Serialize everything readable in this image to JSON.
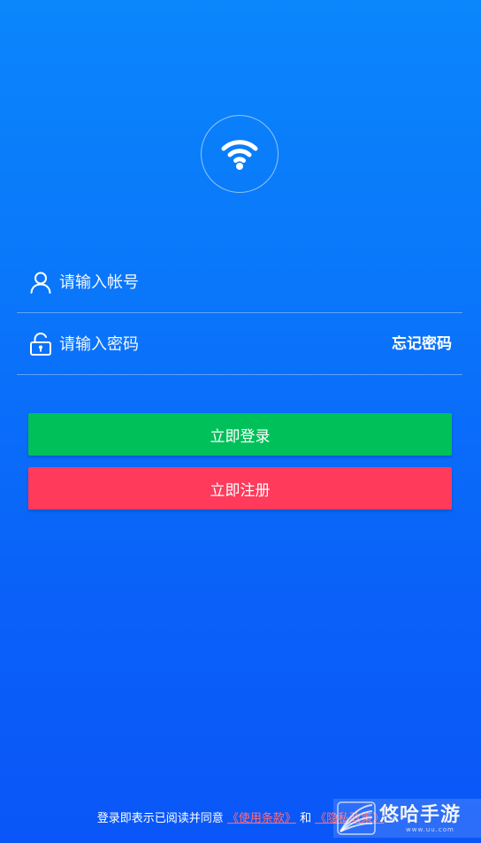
{
  "colors": {
    "background_top": "#0b86fb",
    "background_bottom": "#0a56f8",
    "login_button": "#00c05a",
    "register_button": "#ff3a5b",
    "terms_link": "#ff6d7c"
  },
  "logo": {
    "icon": "wifi-icon"
  },
  "form": {
    "account": {
      "icon": "user-icon",
      "placeholder": "请输入帐号",
      "value": ""
    },
    "password": {
      "icon": "lock-icon",
      "placeholder": "请输入密码",
      "value": "",
      "forgot_label": "忘记密码"
    }
  },
  "buttons": {
    "login_label": "立即登录",
    "register_label": "立即注册"
  },
  "terms": {
    "prefix": "登录即表示已阅读并同意",
    "link_terms": "《使用条款》",
    "conjunction": "和",
    "link_privacy": "《隐私政策》"
  },
  "watermark": {
    "text": "悠哈手游",
    "url": "www.uu.com"
  }
}
